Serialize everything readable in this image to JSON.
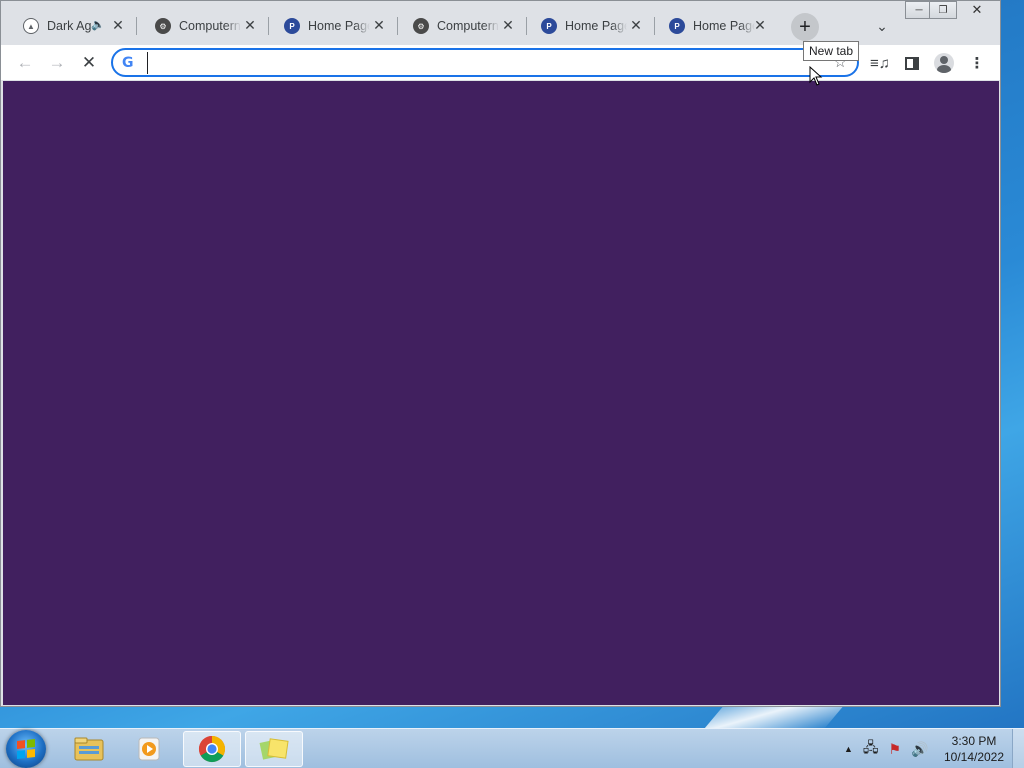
{
  "browser": {
    "tabs": [
      {
        "title": "Dark Ag",
        "favicon": "shield-icon",
        "audio": true
      },
      {
        "title": "Computerne",
        "favicon": "gear-icon",
        "audio": false
      },
      {
        "title": "Home Page",
        "favicon": "pbs-icon",
        "audio": false
      },
      {
        "title": "Computerne",
        "favicon": "gear-icon",
        "audio": false
      },
      {
        "title": "Home Page",
        "favicon": "pbs-icon",
        "audio": false
      },
      {
        "title": "Home Page",
        "favicon": "pbs-icon",
        "audio": false
      }
    ],
    "new_tab_tooltip": "New tab",
    "address_bar_value": "",
    "page_background": "#41205f"
  },
  "taskbar": {
    "apps": [
      "file-explorer-icon",
      "media-player-icon",
      "chrome-icon",
      "sticky-notes-icon"
    ],
    "time": "3:30 PM",
    "date": "10/14/2022"
  }
}
